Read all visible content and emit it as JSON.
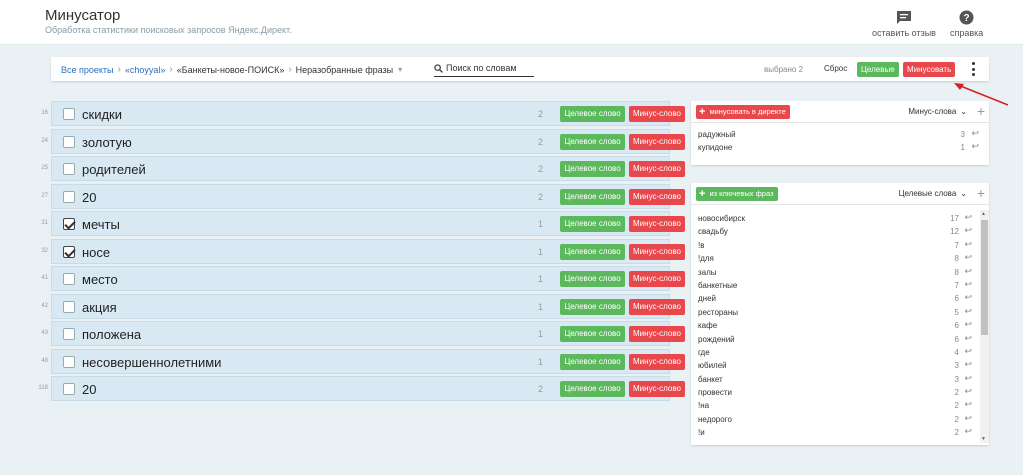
{
  "header": {
    "title": "Минусатор",
    "subtitle": "Обработка статистики поисковых запросов Яндекс.Директ.",
    "feedback_label": "оставить отзыв",
    "help_label": "справка"
  },
  "breadcrumb": {
    "all_projects": "Все проекты",
    "client": "«choyyal»",
    "campaign": "«Банкеты-новое-ПОИСК»",
    "current": "Неразобранные фразы"
  },
  "search": {
    "placeholder": "Поиск по словам"
  },
  "toolbar": {
    "selected": "выбрано 2",
    "reset": "Сброс",
    "target_label": "Целевые",
    "minus_label": "Минусовать"
  },
  "phrases": [
    {
      "num": "16",
      "text": "скидки",
      "count": "2",
      "checked": false
    },
    {
      "num": "24",
      "text": "золотую",
      "count": "2",
      "checked": false
    },
    {
      "num": "25",
      "text": "родителей",
      "count": "2",
      "checked": false
    },
    {
      "num": "27",
      "text": "20",
      "count": "2",
      "checked": false
    },
    {
      "num": "31",
      "text": "мечты",
      "count": "1",
      "checked": true
    },
    {
      "num": "32",
      "text": "носе",
      "count": "1",
      "checked": true
    },
    {
      "num": "41",
      "text": "место",
      "count": "1",
      "checked": false
    },
    {
      "num": "42",
      "text": "акция",
      "count": "1",
      "checked": false
    },
    {
      "num": "43",
      "text": "положена",
      "count": "1",
      "checked": false
    },
    {
      "num": "48",
      "text": "несовершеннолетними",
      "count": "1",
      "checked": false
    },
    {
      "num": "118",
      "text": "20",
      "count": "2",
      "checked": false
    }
  ],
  "row_buttons": {
    "target": "Целевое слово",
    "minus": "Минус-слово"
  },
  "minus_panel": {
    "button": "минусовать в директе",
    "select": "Минус-слова",
    "items": [
      {
        "text": "радужный",
        "count": "3"
      },
      {
        "text": "купидоне",
        "count": "1"
      }
    ]
  },
  "target_panel": {
    "button": "из ключевых фраз",
    "select": "Целевые слова",
    "items": [
      {
        "text": "новосибирск",
        "count": "17"
      },
      {
        "text": "свадьбу",
        "count": "12"
      },
      {
        "text": "!в",
        "count": "7"
      },
      {
        "text": "!для",
        "count": "8"
      },
      {
        "text": "залы",
        "count": "8"
      },
      {
        "text": "банкетные",
        "count": "7"
      },
      {
        "text": "дней",
        "count": "6"
      },
      {
        "text": "рестораны",
        "count": "5"
      },
      {
        "text": "кафе",
        "count": "6"
      },
      {
        "text": "рождений",
        "count": "6"
      },
      {
        "text": "где",
        "count": "4"
      },
      {
        "text": "юбилей",
        "count": "3"
      },
      {
        "text": "банкет",
        "count": "3"
      },
      {
        "text": "провести",
        "count": "2"
      },
      {
        "text": "!на",
        "count": "2"
      },
      {
        "text": "недорого",
        "count": "2"
      },
      {
        "text": "!и",
        "count": "2"
      }
    ]
  },
  "colors": {
    "green": "#5cb85c",
    "red": "#e8474c",
    "accent": "#2a6fbf"
  }
}
